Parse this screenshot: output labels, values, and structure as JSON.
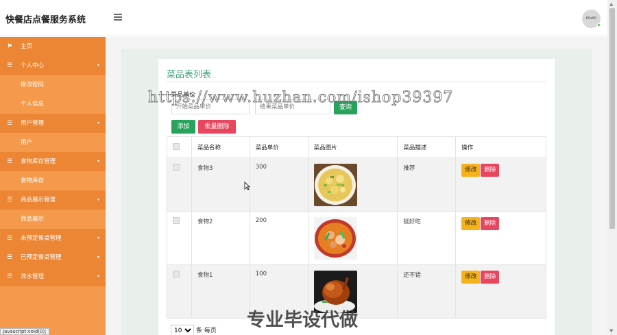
{
  "header": {
    "brand": "快餐店点餐服务系统",
    "avatar_text": "60x60"
  },
  "sidebar": {
    "items": [
      {
        "label": "主页",
        "icon": "flag-icon",
        "type": "home"
      },
      {
        "label": "个人中心",
        "icon": "list-icon",
        "type": "group"
      },
      {
        "label": "修改密码",
        "type": "sub"
      },
      {
        "label": "个人信息",
        "type": "sub"
      },
      {
        "label": "用户管理",
        "icon": "list-icon",
        "type": "group"
      },
      {
        "label": "用户",
        "type": "sub"
      },
      {
        "label": "食物库存管理",
        "icon": "list-icon",
        "type": "group"
      },
      {
        "label": "食物库存",
        "type": "sub"
      },
      {
        "label": "商品展示管理",
        "icon": "list-icon",
        "type": "group"
      },
      {
        "label": "商品展示",
        "type": "sub"
      },
      {
        "label": "未预定餐桌管理",
        "icon": "list-icon",
        "type": "group"
      },
      {
        "label": "已预定餐桌管理",
        "icon": "list-icon",
        "type": "group"
      },
      {
        "label": "流水管理",
        "icon": "list-icon",
        "type": "group"
      }
    ]
  },
  "main": {
    "title": "菜品表列表",
    "search": {
      "label": "菜品单价",
      "min_placeholder": "开始菜品单价",
      "max_placeholder": "结束菜品单价",
      "query_label": "查询"
    },
    "actions": {
      "add_label": "添加",
      "batch_delete_label": "批量删除"
    },
    "table": {
      "headers": [
        "菜品名称",
        "菜品单价",
        "菜品图片",
        "菜品描述",
        "操作"
      ],
      "rows": [
        {
          "name": "食物3",
          "price": "300",
          "desc": "推荐"
        },
        {
          "name": "食物2",
          "price": "200",
          "desc": "挺好吃"
        },
        {
          "name": "食物1",
          "price": "100",
          "desc": "还不错"
        }
      ],
      "edit_label": "修改",
      "delete_label": "删除"
    },
    "pager": {
      "page_size": "10",
      "per_page_label": "条 每页"
    }
  },
  "status_url": "javascript:void(0);",
  "watermark": {
    "url": "https://www.huzhan.com/ishop39397",
    "text": "专业毕设代做"
  }
}
